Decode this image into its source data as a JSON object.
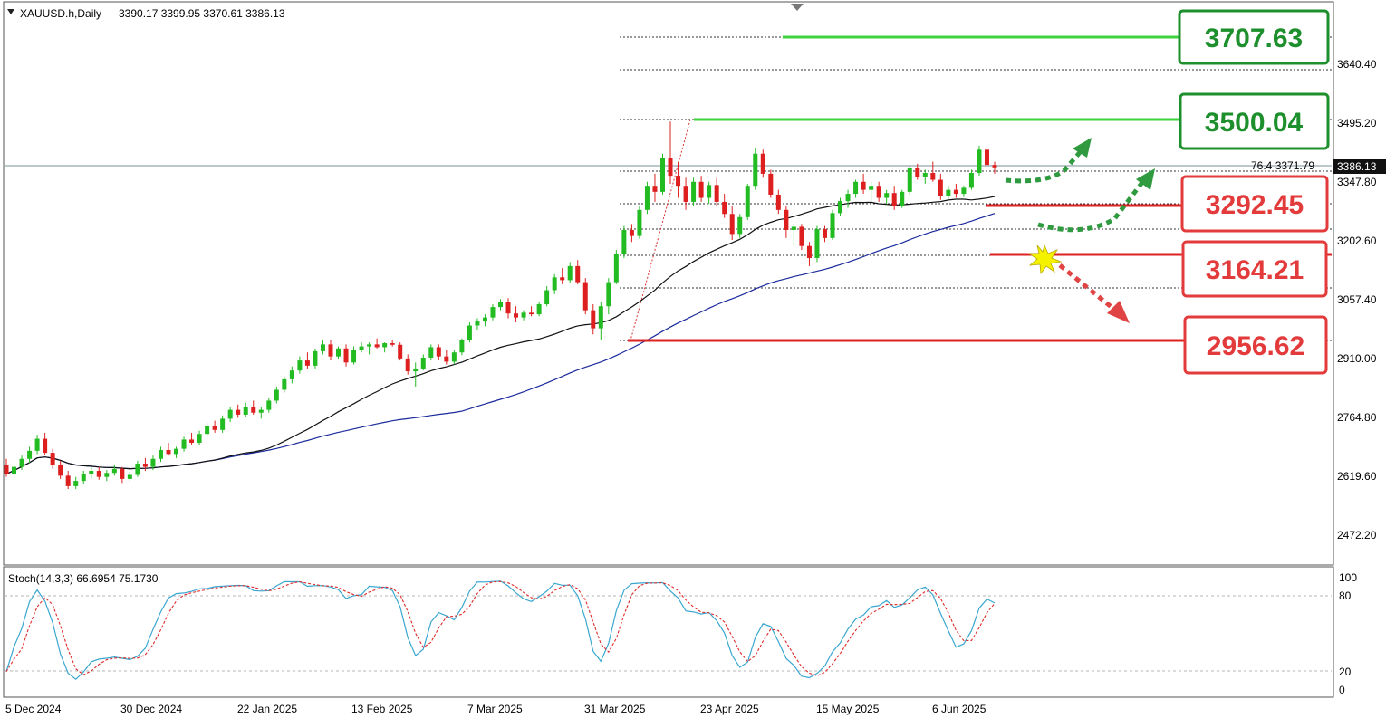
{
  "header": {
    "symbol": "XAUUSD.h,Daily",
    "ohlc": "3390.17 3399.95 3370.61 3386.13"
  },
  "price_axis": {
    "ticks": [
      "3640.40",
      "3495.20",
      "3347.80",
      "3202.60",
      "3057.40",
      "2910.00",
      "2764.80",
      "2619.60",
      "2472.20"
    ],
    "current_price": "3386.13",
    "fib_label": "76.4 3371.79"
  },
  "time_axis": {
    "labels": [
      "5 Dec 2024",
      "30 Dec 2024",
      "22 Jan 2025",
      "13 Feb 2025",
      "7 Mar 2025",
      "31 Mar 2025",
      "23 Apr 2025",
      "15 May 2025",
      "6 Jun 2025"
    ]
  },
  "levels": {
    "resistance_2": "3707.63",
    "resistance_1": "3500.04",
    "support_1": "3292.45",
    "support_2": "3164.21",
    "support_3": "2956.62"
  },
  "stoch": {
    "label": "Stoch(14,3,3) 66.6954 75.1730",
    "ticks": [
      "100",
      "80",
      "20",
      "0"
    ]
  },
  "colors": {
    "bull": "#22bb22",
    "bear": "#dd1f1f",
    "level_green": "#1e8f2d",
    "level_red": "#e33b3b",
    "ma_fast": "#111111",
    "ma_slow": "#1a2a9c",
    "stoch_main": "#3aa7d0",
    "stoch_signal": "#e02a2a"
  },
  "chart_data": {
    "type": "candlestick",
    "instrument": "XAUUSD.h",
    "timeframe": "Daily",
    "ylim": [
      2400,
      3720
    ],
    "candles": [
      [
        2645,
        2660,
        2615,
        2622
      ],
      [
        2622,
        2650,
        2610,
        2640
      ],
      [
        2640,
        2668,
        2632,
        2660
      ],
      [
        2660,
        2690,
        2650,
        2680
      ],
      [
        2680,
        2720,
        2672,
        2710
      ],
      [
        2710,
        2725,
        2670,
        2675
      ],
      [
        2675,
        2685,
        2635,
        2645
      ],
      [
        2645,
        2655,
        2610,
        2618
      ],
      [
        2618,
        2630,
        2585,
        2592
      ],
      [
        2592,
        2615,
        2585,
        2605
      ],
      [
        2605,
        2630,
        2598,
        2622
      ],
      [
        2622,
        2640,
        2612,
        2630
      ],
      [
        2630,
        2640,
        2608,
        2615
      ],
      [
        2615,
        2632,
        2605,
        2625
      ],
      [
        2625,
        2645,
        2618,
        2635
      ],
      [
        2635,
        2640,
        2600,
        2610
      ],
      [
        2610,
        2628,
        2602,
        2620
      ],
      [
        2620,
        2655,
        2615,
        2648
      ],
      [
        2648,
        2662,
        2630,
        2640
      ],
      [
        2640,
        2668,
        2632,
        2660
      ],
      [
        2660,
        2690,
        2652,
        2682
      ],
      [
        2682,
        2700,
        2668,
        2672
      ],
      [
        2672,
        2690,
        2662,
        2685
      ],
      [
        2685,
        2715,
        2678,
        2708
      ],
      [
        2708,
        2725,
        2695,
        2700
      ],
      [
        2700,
        2730,
        2695,
        2722
      ],
      [
        2722,
        2750,
        2715,
        2742
      ],
      [
        2742,
        2755,
        2725,
        2732
      ],
      [
        2732,
        2768,
        2725,
        2760
      ],
      [
        2760,
        2790,
        2752,
        2782
      ],
      [
        2782,
        2795,
        2762,
        2770
      ],
      [
        2770,
        2800,
        2765,
        2790
      ],
      [
        2790,
        2805,
        2770,
        2775
      ],
      [
        2775,
        2790,
        2760,
        2782
      ],
      [
        2782,
        2812,
        2775,
        2805
      ],
      [
        2805,
        2840,
        2798,
        2832
      ],
      [
        2832,
        2865,
        2825,
        2858
      ],
      [
        2858,
        2890,
        2848,
        2880
      ],
      [
        2880,
        2915,
        2872,
        2905
      ],
      [
        2905,
        2925,
        2885,
        2892
      ],
      [
        2892,
        2935,
        2885,
        2928
      ],
      [
        2928,
        2955,
        2920,
        2945
      ],
      [
        2945,
        2955,
        2905,
        2915
      ],
      [
        2915,
        2940,
        2908,
        2935
      ],
      [
        2935,
        2945,
        2890,
        2900
      ],
      [
        2900,
        2940,
        2895,
        2932
      ],
      [
        2932,
        2950,
        2925,
        2940
      ],
      [
        2940,
        2950,
        2920,
        2945
      ],
      [
        2945,
        2960,
        2935,
        2938
      ],
      [
        2938,
        2950,
        2925,
        2948
      ],
      [
        2948,
        2955,
        2940,
        2944
      ],
      [
        2944,
        2950,
        2905,
        2910
      ],
      [
        2910,
        2920,
        2870,
        2878
      ],
      [
        2878,
        2900,
        2840,
        2885
      ],
      [
        2885,
        2920,
        2880,
        2912
      ],
      [
        2912,
        2945,
        2905,
        2938
      ],
      [
        2938,
        2945,
        2905,
        2915
      ],
      [
        2915,
        2930,
        2895,
        2902
      ],
      [
        2902,
        2930,
        2895,
        2925
      ],
      [
        2925,
        2960,
        2918,
        2955
      ],
      [
        2955,
        3000,
        2950,
        2992
      ],
      [
        2992,
        3010,
        2982,
        3002
      ],
      [
        3002,
        3020,
        2990,
        3012
      ],
      [
        3012,
        3045,
        3005,
        3038
      ],
      [
        3038,
        3058,
        3030,
        3050
      ],
      [
        3050,
        3060,
        3010,
        3022
      ],
      [
        3022,
        3040,
        3000,
        3012
      ],
      [
        3012,
        3030,
        3005,
        3024
      ],
      [
        3024,
        3040,
        3015,
        3020
      ],
      [
        3020,
        3050,
        3015,
        3045
      ],
      [
        3045,
        3090,
        3040,
        3080
      ],
      [
        3080,
        3120,
        3070,
        3112
      ],
      [
        3112,
        3135,
        3095,
        3105
      ],
      [
        3105,
        3150,
        3098,
        3140
      ],
      [
        3140,
        3155,
        3095,
        3100
      ],
      [
        3100,
        3110,
        3020,
        3030
      ],
      [
        3030,
        3045,
        2970,
        2985
      ],
      [
        2985,
        3050,
        2957,
        3040
      ],
      [
        3040,
        3110,
        3020,
        3100
      ],
      [
        3100,
        3180,
        3095,
        3170
      ],
      [
        3170,
        3240,
        3160,
        3230
      ],
      [
        3230,
        3245,
        3200,
        3215
      ],
      [
        3215,
        3290,
        3208,
        3280
      ],
      [
        3280,
        3350,
        3270,
        3340
      ],
      [
        3340,
        3370,
        3300,
        3325
      ],
      [
        3325,
        3420,
        3318,
        3410
      ],
      [
        3410,
        3500,
        3345,
        3365
      ],
      [
        3365,
        3400,
        3310,
        3340
      ],
      [
        3340,
        3360,
        3280,
        3300
      ],
      [
        3300,
        3360,
        3290,
        3350
      ],
      [
        3350,
        3365,
        3300,
        3310
      ],
      [
        3310,
        3350,
        3295,
        3342
      ],
      [
        3342,
        3360,
        3290,
        3300
      ],
      [
        3300,
        3320,
        3260,
        3270
      ],
      [
        3270,
        3290,
        3205,
        3220
      ],
      [
        3220,
        3270,
        3210,
        3262
      ],
      [
        3262,
        3345,
        3255,
        3340
      ],
      [
        3340,
        3435,
        3330,
        3420
      ],
      [
        3420,
        3430,
        3360,
        3370
      ],
      [
        3370,
        3380,
        3310,
        3318
      ],
      [
        3318,
        3330,
        3270,
        3280
      ],
      [
        3280,
        3290,
        3210,
        3230
      ],
      [
        3230,
        3245,
        3190,
        3238
      ],
      [
        3238,
        3245,
        3180,
        3190
      ],
      [
        3190,
        3200,
        3140,
        3160
      ],
      [
        3160,
        3240,
        3150,
        3232
      ],
      [
        3232,
        3240,
        3200,
        3210
      ],
      [
        3210,
        3280,
        3205,
        3272
      ],
      [
        3272,
        3310,
        3265,
        3302
      ],
      [
        3302,
        3330,
        3285,
        3320
      ],
      [
        3320,
        3355,
        3310,
        3350
      ],
      [
        3350,
        3370,
        3320,
        3330
      ],
      [
        3330,
        3350,
        3300,
        3340
      ],
      [
        3340,
        3350,
        3300,
        3310
      ],
      [
        3310,
        3330,
        3295,
        3322
      ],
      [
        3322,
        3340,
        3280,
        3290
      ],
      [
        3290,
        3330,
        3285,
        3325
      ],
      [
        3325,
        3390,
        3318,
        3385
      ],
      [
        3385,
        3395,
        3355,
        3362
      ],
      [
        3362,
        3380,
        3345,
        3372
      ],
      [
        3372,
        3400,
        3350,
        3355
      ],
      [
        3355,
        3370,
        3305,
        3315
      ],
      [
        3315,
        3340,
        3308,
        3330
      ],
      [
        3330,
        3345,
        3310,
        3320
      ],
      [
        3320,
        3340,
        3312,
        3335
      ],
      [
        3335,
        3380,
        3330,
        3372
      ],
      [
        3372,
        3440,
        3365,
        3430
      ],
      [
        3430,
        3440,
        3385,
        3392
      ],
      [
        3392,
        3400,
        3370,
        3386
      ]
    ],
    "price_levels": [
      3707.63,
      3500.04,
      3292.45,
      3164.21,
      2956.62
    ],
    "fib_ratio_label": "76.4",
    "fib_ratio_price": 3371.79,
    "current_price": 3386.13,
    "stochastic": {
      "params": "14,3,3",
      "main_last": 66.6954,
      "signal_last": 75.173,
      "overbought": 80,
      "oversold": 20,
      "ylim": [
        0,
        100
      ]
    }
  }
}
